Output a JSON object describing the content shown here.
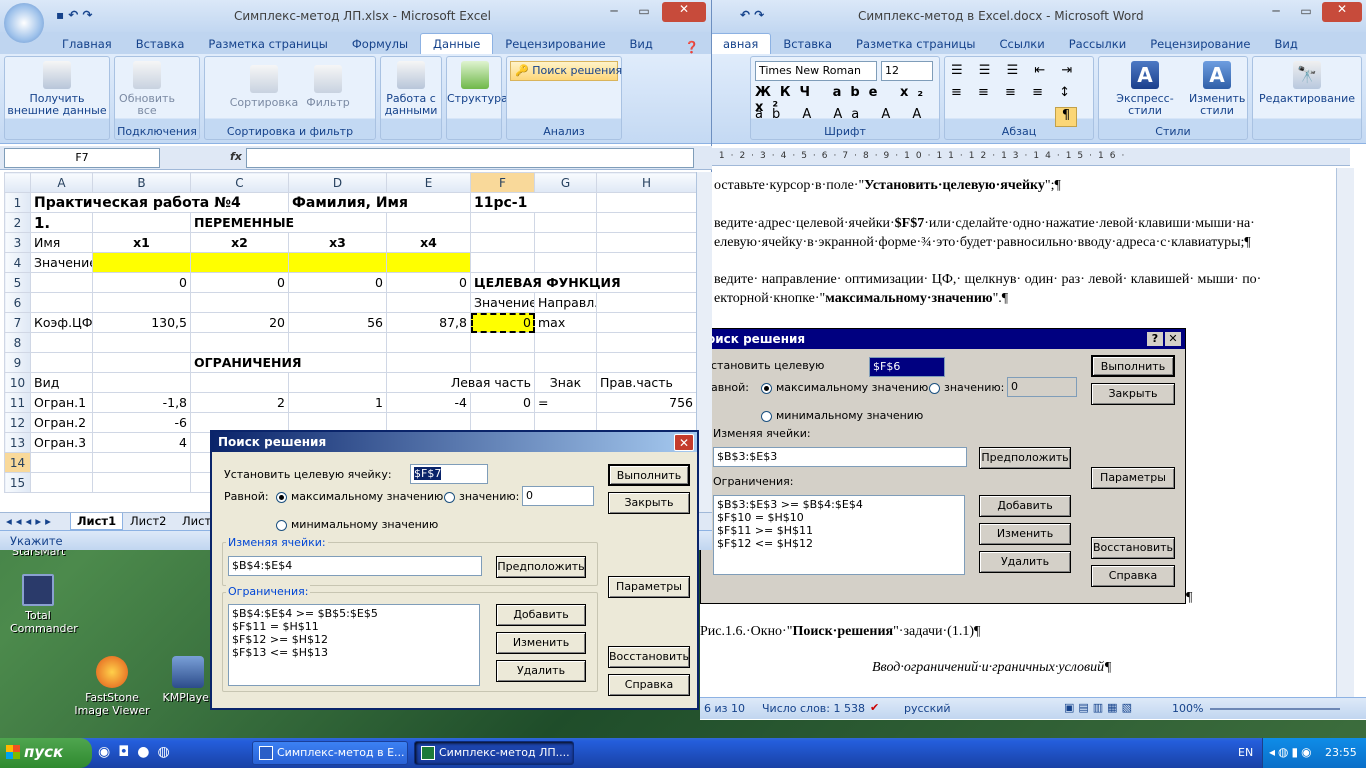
{
  "excel": {
    "title": "Симплекс-метод ЛП.xlsx - Microsoft Excel",
    "tabs": [
      "Главная",
      "Вставка",
      "Разметка страницы",
      "Формулы",
      "Данные",
      "Рецензирование",
      "Вид"
    ],
    "active_tab": "Данные",
    "ribbon": {
      "get_external": "Получить внешние данные",
      "refresh": "Обновить все",
      "connections_group": "Подключения",
      "sort": "Сортировка",
      "filter": "Фильтр",
      "sort_filter_group": "Сортировка и фильтр",
      "data_tools": "Работа с данными",
      "structure": "Структура",
      "solver": "Поиск решения",
      "analysis_group": "Анализ"
    },
    "name_box": "F7",
    "fx": "fx",
    "columns": [
      "A",
      "B",
      "C",
      "D",
      "E",
      "F",
      "G",
      "H"
    ],
    "rows": [
      [
        "1",
        "Практическая работа №4",
        "",
        "Фамилия, Имя",
        "",
        "11рс-1",
        "",
        ""
      ],
      [
        "2",
        "1.",
        "ПЕРЕМЕННЫЕ",
        "",
        "",
        "",
        "",
        ""
      ],
      [
        "3",
        "Имя",
        "x1",
        "x2",
        "x3",
        "x4",
        "",
        ""
      ],
      [
        "4",
        "Значение",
        "",
        "",
        "",
        "",
        "",
        ""
      ],
      [
        "5",
        "",
        "0",
        "0",
        "0",
        "0",
        "ЦЕЛЕВАЯ ФУНКЦИЯ",
        ""
      ],
      [
        "6",
        "",
        "",
        "",
        "",
        "Значение",
        "Направл.",
        ""
      ],
      [
        "7",
        "Коэф.ЦФ",
        "130,5",
        "20",
        "56",
        "87,8",
        "0",
        "max"
      ],
      [
        "8",
        "",
        "",
        "",
        "",
        "",
        "",
        ""
      ],
      [
        "9",
        "",
        "",
        "ОГРАНИЧЕНИЯ",
        "",
        "",
        "",
        ""
      ],
      [
        "10",
        "Вид",
        "",
        "",
        "",
        "Левая часть",
        "Знак",
        "Прав.часть"
      ],
      [
        "11",
        "Огран.1",
        "-1,8",
        "2",
        "1",
        "-4",
        "0",
        "=",
        "756"
      ],
      [
        "12",
        "Огран.2",
        "-6",
        "",
        "",
        "",
        "",
        ""
      ],
      [
        "13",
        "Огран.3",
        "4",
        "",
        "",
        "",
        "",
        ""
      ],
      [
        "14",
        "",
        "",
        "",
        "",
        "",
        "",
        ""
      ],
      [
        "15",
        "",
        "",
        "",
        "",
        "",
        "",
        ""
      ]
    ],
    "sheet_tabs": [
      "Лист1",
      "Лист2",
      "Лист"
    ],
    "status": "Укажите"
  },
  "solver_excel": {
    "title": "Поиск решения",
    "target_label": "Установить целевую ячейку:",
    "target_value": "$F$7",
    "equal_label": "Равной:",
    "max_label": "максимальному значению",
    "value_label": "значению:",
    "value_field": "0",
    "min_label": "минимальному значению",
    "changing_label": "Изменяя ячейки:",
    "changing_value": "$B$4:$E$4",
    "guess": "Предположить",
    "constraints_label": "Ограничения:",
    "constraints": "$B$4:$E$4 >= $B$5:$E$5\n$F$11 = $H$11\n$F$12 >= $H$12\n$F$13 <= $H$13",
    "run": "Выполнить",
    "close": "Закрыть",
    "params": "Параметры",
    "add": "Добавить",
    "change": "Изменить",
    "delete": "Удалить",
    "restore": "Восстановить",
    "help": "Справка"
  },
  "word": {
    "title": "Симплекс-метод в Excel.docx - Microsoft Word",
    "tabs": [
      "Вставка",
      "Разметка страницы",
      "Ссылки",
      "Рассылки",
      "Рецензирование",
      "Вид"
    ],
    "font": "Times New Roman",
    "size": "12",
    "groups": [
      "Шрифт",
      "Абзац",
      "Стили"
    ],
    "express_styles": "Экспресс-стили",
    "change_styles": "Изменить стили",
    "editing": "Редактирование",
    "line1a": "оставьте·курсор·в·поле·\"",
    "line1b": "Установить·целевую·ячейку",
    "line1c": "\";¶",
    "line2a": "ведите·адрес·целевой·ячейки·",
    "line2b": "$F$7",
    "line2c": "·или·сделайте·одно·нажатие·левой·клавиши·мыши·на·",
    "line3": "елевую·ячейку·в·экранной·форме·¾·это·будет·равносильно·вводу·адреса·с·клавиатуры;¶",
    "line4": "ведите· направление· оптимизации· ЦФ,· щелкнув· один· раз· левой· клавишей· мыши· по·",
    "line5a": "екторной·кнопке·\"",
    "line5b": "максимальному·значению",
    "line5c": "\".¶",
    "caption_a": "Рис.1.6.·Окно·\"",
    "caption_b": "Поиск·решения",
    "caption_c": "\"·задачи·(1.1)¶",
    "heading": "Ввод·ограничений·и·граничных·условий¶",
    "status_page": "6 из 10",
    "status_words": "Число слов: 1 538",
    "status_lang": "русский",
    "zoom": "100%"
  },
  "solver_word": {
    "title": "оиск решения",
    "target_label": "становить целевую",
    "target_value": "$F$6",
    "equal_label": "авной:",
    "max_label": "максимальному значению",
    "value_label": "значению:",
    "value_field": "0",
    "min_label": "минимальному значению",
    "changing_label": "Изменяя ячейки:",
    "changing_value": "$B$3:$E$3",
    "guess": "Предположить",
    "constraints_label": "Ограничения:",
    "constraints": "$B$3:$E$3 >= $B$4:$E$4\n$F$10 = $H$10\n$F$11 >= $H$11\n$F$12 <= $H$12",
    "run": "Выполнить",
    "close": "Закрыть",
    "params": "Параметры",
    "add": "Добавить",
    "change": "Изменить",
    "delete": "Удалить",
    "restore": "Восстановить",
    "help": "Справка"
  },
  "desktop": {
    "icon1": "Total Commander",
    "icon2": "FastStone Image Viewer",
    "icon3": "KMPlayer",
    "partial": "StarsMart"
  },
  "taskbar": {
    "start": "пуск",
    "task1": "Симплекс-метод в E...",
    "task2": "Симплекс-метод ЛП....",
    "lang": "EN",
    "time": "23:55"
  }
}
